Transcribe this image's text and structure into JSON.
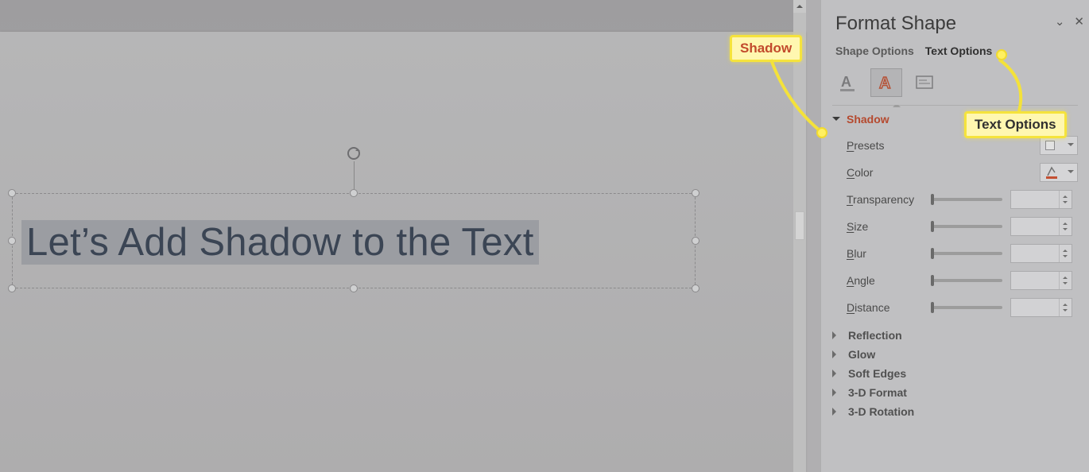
{
  "pane": {
    "title": "Format Shape",
    "tabs": {
      "shape": "Shape Options",
      "text": "Text Options"
    },
    "icons": {
      "fill": "text-fill-icon",
      "effects": "text-effects-icon",
      "textbox": "textbox-icon"
    },
    "sections": {
      "shadow": {
        "title": "Shadow",
        "presets_label": "Presets",
        "color_label": "Color",
        "transparency_label": "Transparency",
        "size_label": "Size",
        "blur_label": "Blur",
        "angle_label": "Angle",
        "distance_label": "Distance"
      },
      "reflection": "Reflection",
      "glow": "Glow",
      "softedges": "Soft Edges",
      "format3d": "3-D Format",
      "rotation3d": "3-D Rotation"
    }
  },
  "slide": {
    "text": "Let’s Add Shadow to the Text"
  },
  "callouts": {
    "shadow": "Shadow",
    "textoptions": "Text Options"
  }
}
